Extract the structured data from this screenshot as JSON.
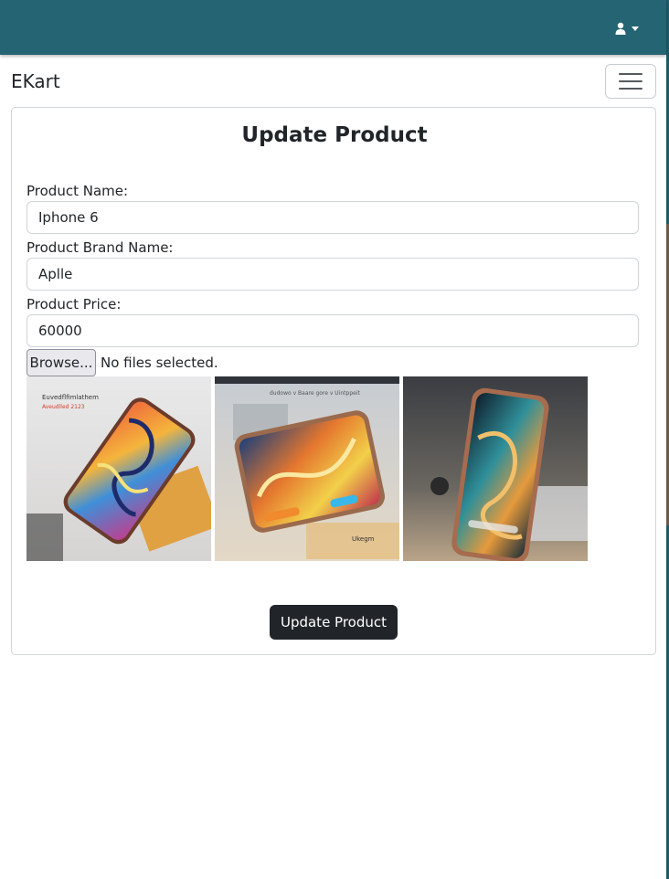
{
  "navbar": {
    "brand": "EKart",
    "user_icon": "user-icon",
    "caret_icon": "caret-down-icon",
    "toggler_icon": "hamburger-icon",
    "background": "#256473"
  },
  "form": {
    "title": "Update Product",
    "name_label": "Product Name:",
    "name_value": "Iphone 6",
    "brand_label": "Product Brand Name:",
    "brand_value": "Aplle",
    "price_label": "Product Price:",
    "price_value": "60000",
    "file_button": "Browse...",
    "file_status": "No files selected.",
    "images": [
      {
        "caption_line1": "Euvedflfimlathem",
        "caption_line2": "Aveudlled 2123"
      },
      {
        "caption_line1": "dudowo v Baare gore v Uintppeit",
        "caption_line2": "Ukegm"
      },
      {
        "caption_line1": "",
        "caption_line2": ""
      }
    ],
    "submit_label": "Update Product"
  }
}
